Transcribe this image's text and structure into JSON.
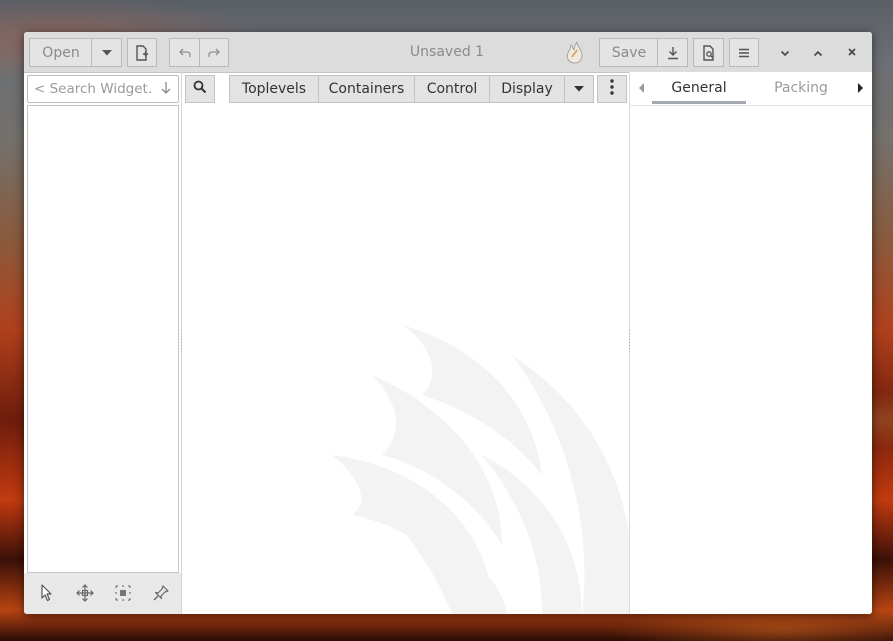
{
  "window": {
    "title": "Unsaved 1"
  },
  "header": {
    "open_label": "Open",
    "save_label": "Save",
    "icons": [
      "open-dropdown-icon",
      "new-document-icon",
      "undo-icon",
      "redo-icon",
      "app-logo-icon",
      "save-as-icon",
      "preview-icon",
      "menu-icon",
      "minimize-icon",
      "maximize-icon",
      "close-icon"
    ]
  },
  "search": {
    "placeholder": "< Search Widget…"
  },
  "palette": {
    "tabs": [
      "Toplevels",
      "Containers",
      "Control",
      "Display"
    ]
  },
  "inspector": {
    "tabs": [
      "General",
      "Packing"
    ],
    "active_tab": "General"
  },
  "left_tools": [
    "pointer-icon",
    "drag-resize-icon",
    "margin-icon",
    "align-icon"
  ],
  "colors": {
    "accent_underline": "#a5aab0",
    "header_bg": "#dcdcdc"
  }
}
